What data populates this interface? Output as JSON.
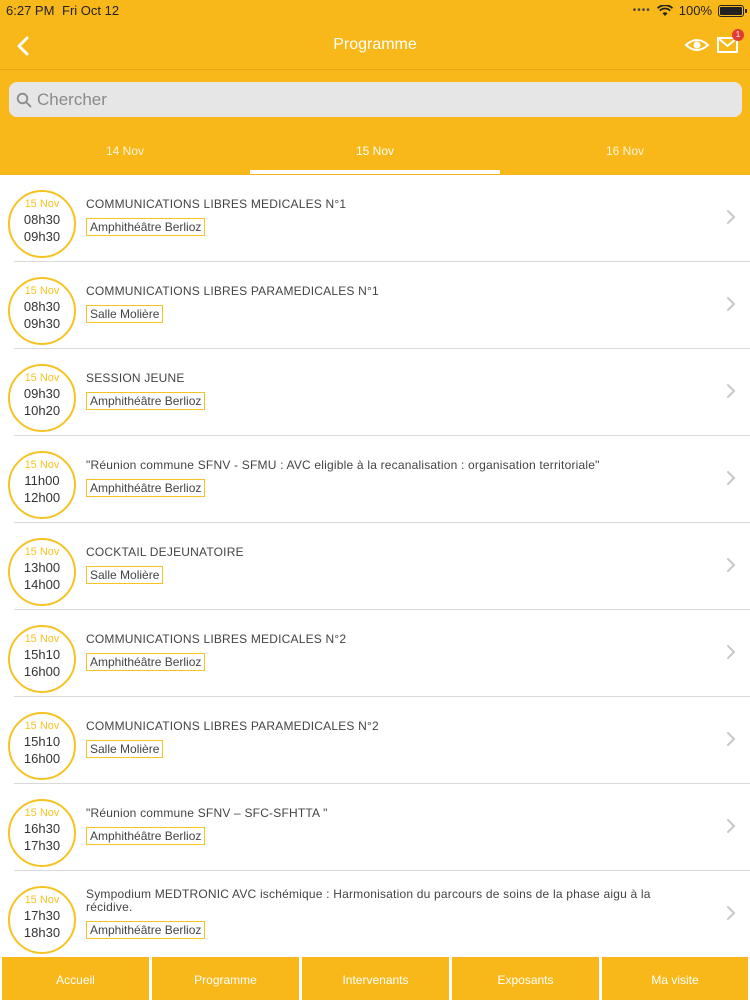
{
  "status_bar": {
    "time": "6:27 PM",
    "date": "Fri Oct 12",
    "battery": "100%"
  },
  "nav": {
    "title": "Programme",
    "mail_badge": "1"
  },
  "search": {
    "placeholder": "Chercher"
  },
  "tabs": [
    {
      "label": "14 Nov"
    },
    {
      "label": "15 Nov"
    },
    {
      "label": "16 Nov"
    }
  ],
  "sessions": [
    {
      "date": "15 Nov",
      "start": "08h30",
      "end": "09h30",
      "title": "COMMUNICATIONS LIBRES MEDICALES N°1",
      "room": "Amphithéâtre Berlioz"
    },
    {
      "date": "15 Nov",
      "start": "08h30",
      "end": "09h30",
      "title": "COMMUNICATIONS LIBRES PARAMEDICALES N°1",
      "room": "Salle Molière"
    },
    {
      "date": "15 Nov",
      "start": "09h30",
      "end": "10h20",
      "title": "SESSION JEUNE",
      "room": "Amphithéâtre Berlioz"
    },
    {
      "date": "15 Nov",
      "start": "11h00",
      "end": "12h00",
      "title": "\"Réunion commune SFNV - SFMU : AVC eligible à la recanalisation : organisation territoriale\"",
      "room": "Amphithéâtre Berlioz"
    },
    {
      "date": "15 Nov",
      "start": "13h00",
      "end": "14h00",
      "title": "COCKTAIL DEJEUNATOIRE",
      "room": "Salle Molière"
    },
    {
      "date": "15 Nov",
      "start": "15h10",
      "end": "16h00",
      "title": "COMMUNICATIONS LIBRES MEDICALES N°2",
      "room": "Amphithéâtre Berlioz"
    },
    {
      "date": "15 Nov",
      "start": "15h10",
      "end": "16h00",
      "title": "COMMUNICATIONS LIBRES PARAMEDICALES N°2",
      "room": "Salle Molière"
    },
    {
      "date": "15 Nov",
      "start": "16h30",
      "end": "17h30",
      "title": "\"Réunion commune SFNV – SFC-SFHTTA \"",
      "room": "Amphithéâtre Berlioz"
    },
    {
      "date": "15 Nov",
      "start": "17h30",
      "end": "18h30",
      "title": "Sympodium MEDTRONIC AVC ischémique : Harmonisation du parcours de soins de la phase aigu à la récidive.",
      "room": "Amphithéâtre Berlioz"
    }
  ],
  "bottom_tabs": [
    {
      "label": "Accueil"
    },
    {
      "label": "Programme"
    },
    {
      "label": "Intervenants"
    },
    {
      "label": "Exposants"
    },
    {
      "label": "Ma visite"
    }
  ],
  "colors": {
    "accent": "#f9b81a",
    "circle": "#f6c324"
  }
}
